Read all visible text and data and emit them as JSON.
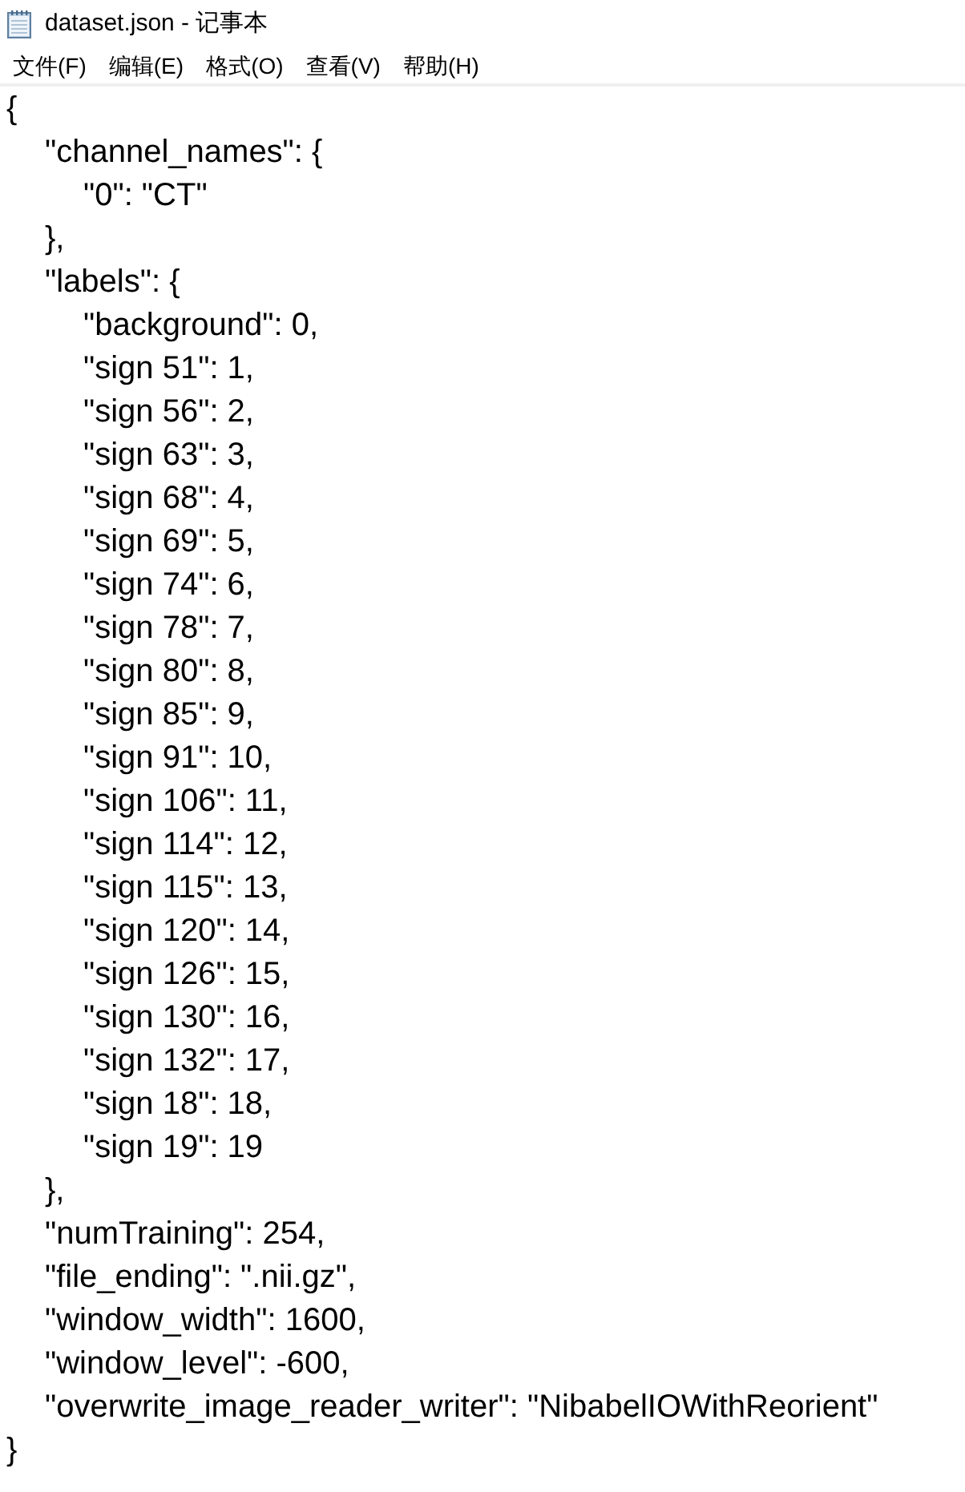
{
  "window": {
    "title": "dataset.json - 记事本"
  },
  "menu": [
    {
      "label": "文件(F)"
    },
    {
      "label": "编辑(E)"
    },
    {
      "label": "格式(O)"
    },
    {
      "label": "查看(V)"
    },
    {
      "label": "帮助(H)"
    }
  ],
  "document": {
    "lines": [
      {
        "text": "{",
        "children": [
          {
            "text": "\"channel_names\": {",
            "children": [
              {
                "text": "\"0\": \"CT\""
              }
            ]
          },
          {
            "text": "},"
          },
          {
            "text": "\"labels\": {",
            "children": [
              {
                "text": "\"background\": 0,"
              },
              {
                "text": "\"sign 51\": 1,"
              },
              {
                "text": "\"sign 56\": 2,"
              },
              {
                "text": "\"sign 63\": 3,"
              },
              {
                "text": "\"sign 68\": 4,"
              },
              {
                "text": "\"sign 69\": 5,"
              },
              {
                "text": "\"sign 74\": 6,"
              },
              {
                "text": "\"sign 78\": 7,"
              },
              {
                "text": "\"sign 80\": 8,"
              },
              {
                "text": "\"sign 85\": 9,"
              },
              {
                "text": "\"sign 91\": 10,"
              },
              {
                "text": "\"sign 106\": 11,"
              },
              {
                "text": "\"sign 114\": 12,"
              },
              {
                "text": "\"sign 115\": 13,"
              },
              {
                "text": "\"sign 120\": 14,"
              },
              {
                "text": "\"sign 126\": 15,"
              },
              {
                "text": "\"sign 130\": 16,"
              },
              {
                "text": "\"sign 132\": 17,"
              },
              {
                "text": "\"sign 18\": 18,"
              },
              {
                "text": "\"sign 19\": 19"
              }
            ]
          },
          {
            "text": "},"
          },
          {
            "text": "\"numTraining\": 254,"
          },
          {
            "text": "\"file_ending\": \".nii.gz\","
          },
          {
            "text": "\"window_width\": 1600,"
          },
          {
            "text": "\"window_level\": -600,"
          },
          {
            "text": "\"overwrite_image_reader_writer\": \"NibabelIOWithReorient\""
          }
        ]
      },
      {
        "text": "}"
      }
    ]
  }
}
